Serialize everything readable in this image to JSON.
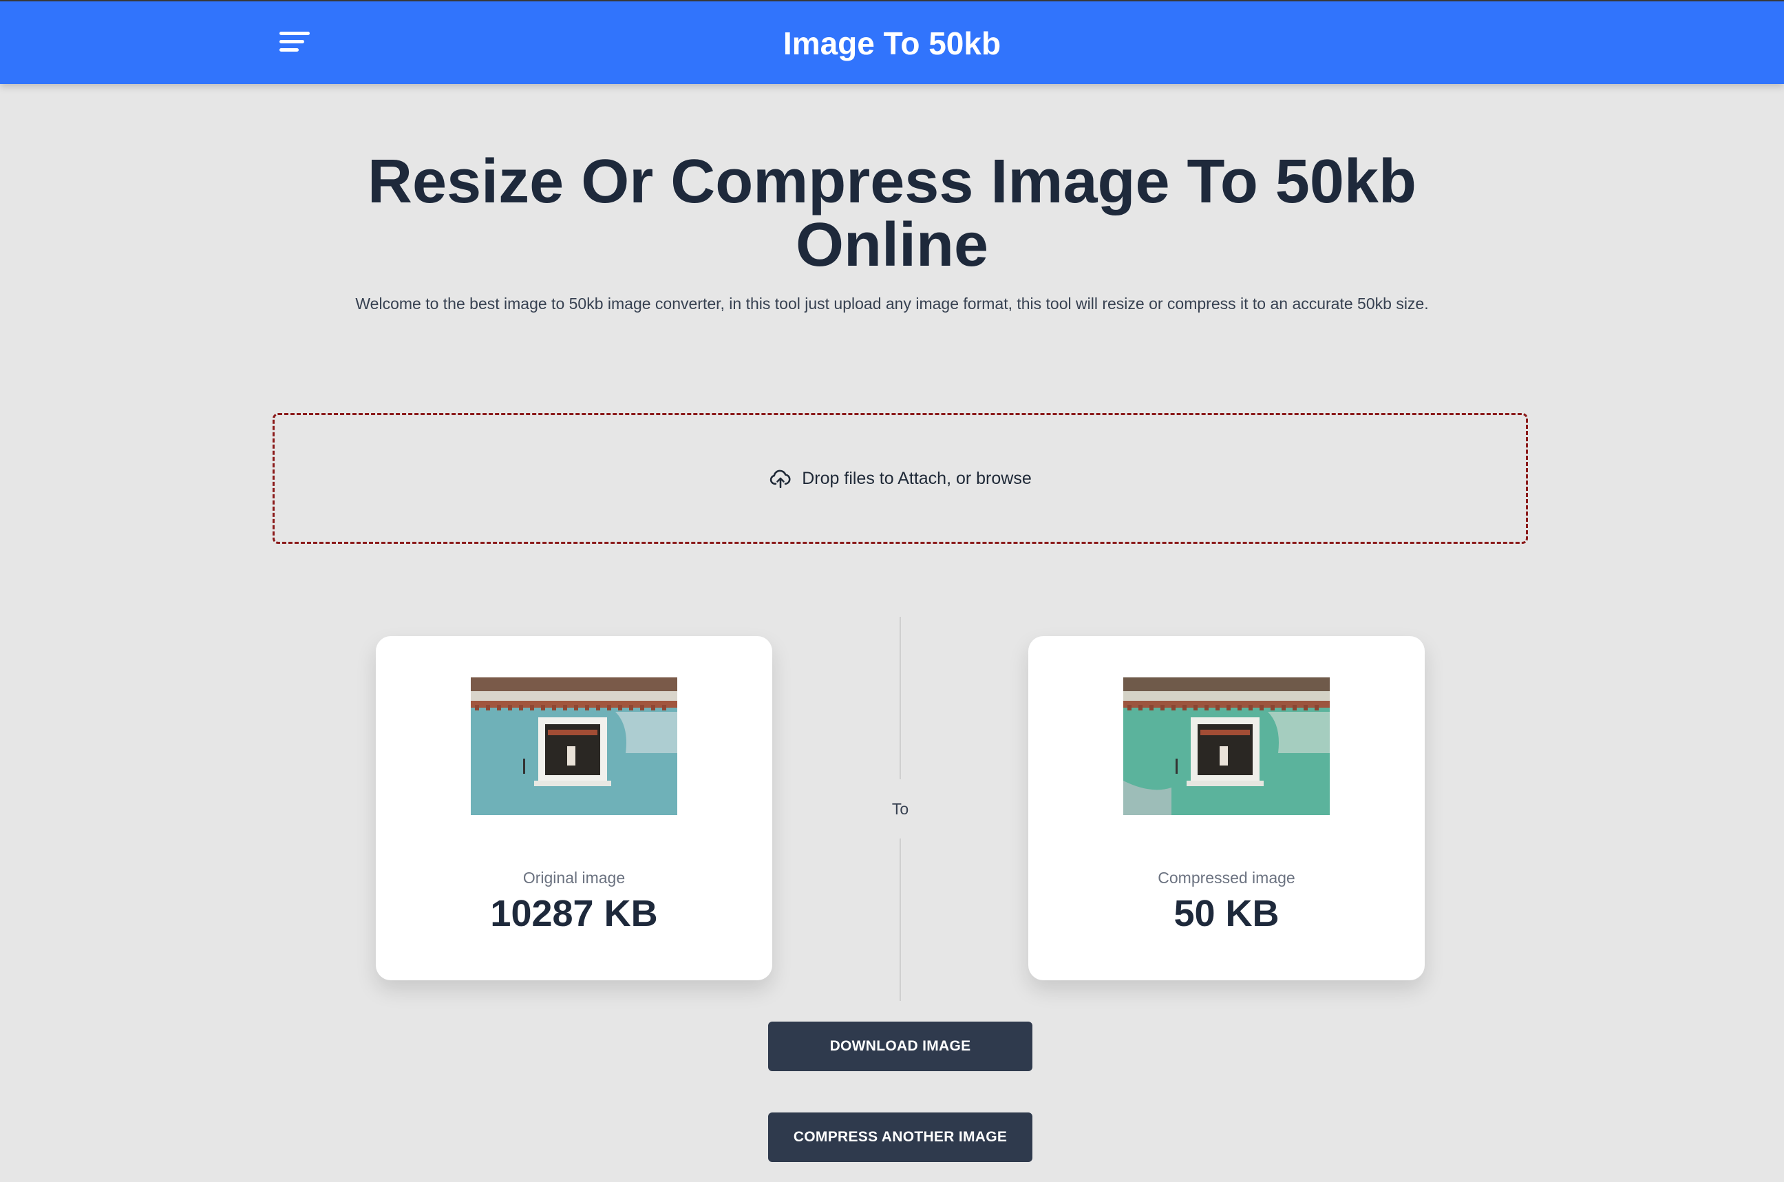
{
  "header": {
    "title": "Image To 50kb",
    "menu_icon": "hamburger-menu-icon",
    "background": "#3174fc"
  },
  "hero": {
    "title_line1": "Resize Or Compress Image To 50kb",
    "title_line2": "Online",
    "subtitle": "Welcome to the best image to 50kb image converter, in this tool just upload any image format, this tool will resize or compress it to an accurate 50kb size."
  },
  "dropzone": {
    "icon": "cloud-upload-icon",
    "text": "Drop files to Attach, or browse",
    "border_color": "#8b1a1a"
  },
  "comparison": {
    "original": {
      "label": "Original image",
      "size": "10287 KB"
    },
    "separator": "To",
    "compressed": {
      "label": "Compressed image",
      "size": "50 KB"
    }
  },
  "actions": {
    "download_label": "DOWNLOAD IMAGE",
    "another_label": "COMPRESS ANOTHER IMAGE",
    "button_color": "#2f3a4d"
  }
}
